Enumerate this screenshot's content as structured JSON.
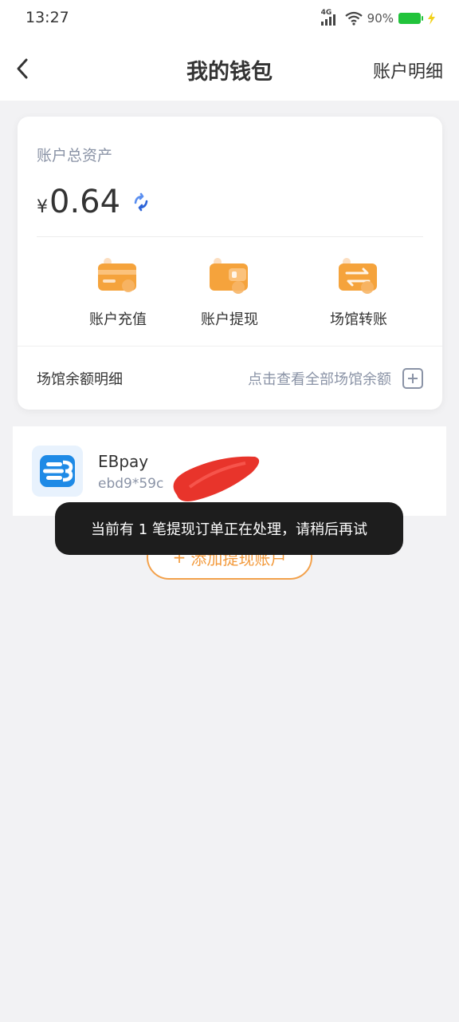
{
  "status_bar": {
    "time": "13:27",
    "network": "4G",
    "battery": "90%",
    "battery_level": 0.9
  },
  "nav": {
    "title": "我的钱包",
    "right_label": "账户明细",
    "back_icon": "chevron-left-icon"
  },
  "wallet": {
    "assets_label": "账户总资产",
    "currency": "¥",
    "amount": "0.64",
    "actions": [
      {
        "label": "账户充值",
        "icon": "card-icon"
      },
      {
        "label": "账户提现",
        "icon": "wallet-icon"
      },
      {
        "label": "场馆转账",
        "icon": "transfer-icon"
      }
    ],
    "venue_label": "场馆余额明细",
    "venue_link": "点击查看全部场馆余额"
  },
  "account": {
    "name": "EBpay",
    "number": "ebd9*59c",
    "logo_icon": "ebpay-logo"
  },
  "add_account": {
    "label": "添加提现账户",
    "plus": "+"
  },
  "toast": {
    "message": "当前有 1 笔提现订单正在处理，请稍后再试"
  },
  "colors": {
    "accent_orange": "#f39a3c",
    "muted_text": "#8a93a6",
    "background": "#f2f2f4"
  }
}
